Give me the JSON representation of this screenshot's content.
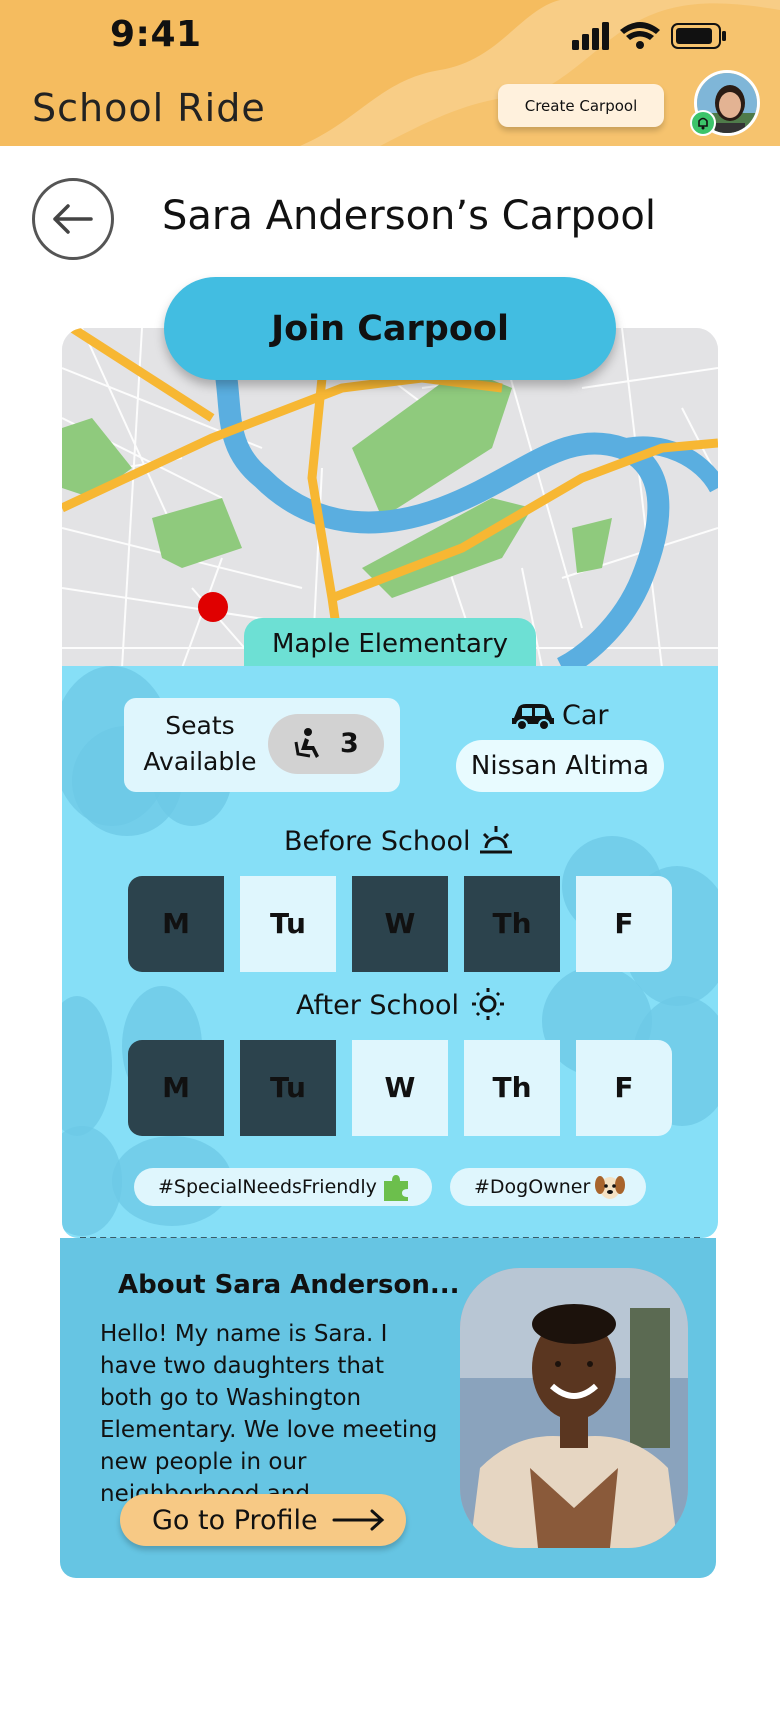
{
  "status_bar": {
    "time": "9:41"
  },
  "header": {
    "app_title": "School Ride",
    "create_button": "Create Carpool"
  },
  "page": {
    "title": "Sara Anderson’s Carpool"
  },
  "join_button": "Join Carpool",
  "map": {
    "destination": "Maple Elementary"
  },
  "seats": {
    "label_line1": "Seats",
    "label_line2": "Available",
    "count": "3"
  },
  "car": {
    "label": "Car",
    "model": "Nissan Altima"
  },
  "before_school": {
    "label": "Before School",
    "days": [
      {
        "label": "M",
        "active": true
      },
      {
        "label": "Tu",
        "active": false
      },
      {
        "label": "W",
        "active": true
      },
      {
        "label": "Th",
        "active": true
      },
      {
        "label": "F",
        "active": false
      }
    ]
  },
  "after_school": {
    "label": "After School",
    "days": [
      {
        "label": "M",
        "active": true
      },
      {
        "label": "Tu",
        "active": true
      },
      {
        "label": "W",
        "active": false
      },
      {
        "label": "Th",
        "active": false
      },
      {
        "label": "F",
        "active": false
      }
    ]
  },
  "tags": [
    {
      "text": "#SpecialNeedsFriendly",
      "icon": "puzzle-icon"
    },
    {
      "text": "#DogOwner",
      "icon": "dog-icon"
    }
  ],
  "about": {
    "title": "About Sara Anderson...",
    "text": "Hello! My name is Sara. I have two daughters that both go to Washington Elementary. We love meeting new people in our neighborhood and...",
    "profile_button": "Go to Profile"
  },
  "colors": {
    "header": "#f5bc5f",
    "join_button": "#42bde1",
    "info_panel": "#86dff7",
    "about_panel": "#66c5e3",
    "active_day": "#2c434d",
    "inactive_day": "#dff6fd",
    "school_tag": "#6de0d4",
    "profile_button": "#f7c985"
  }
}
